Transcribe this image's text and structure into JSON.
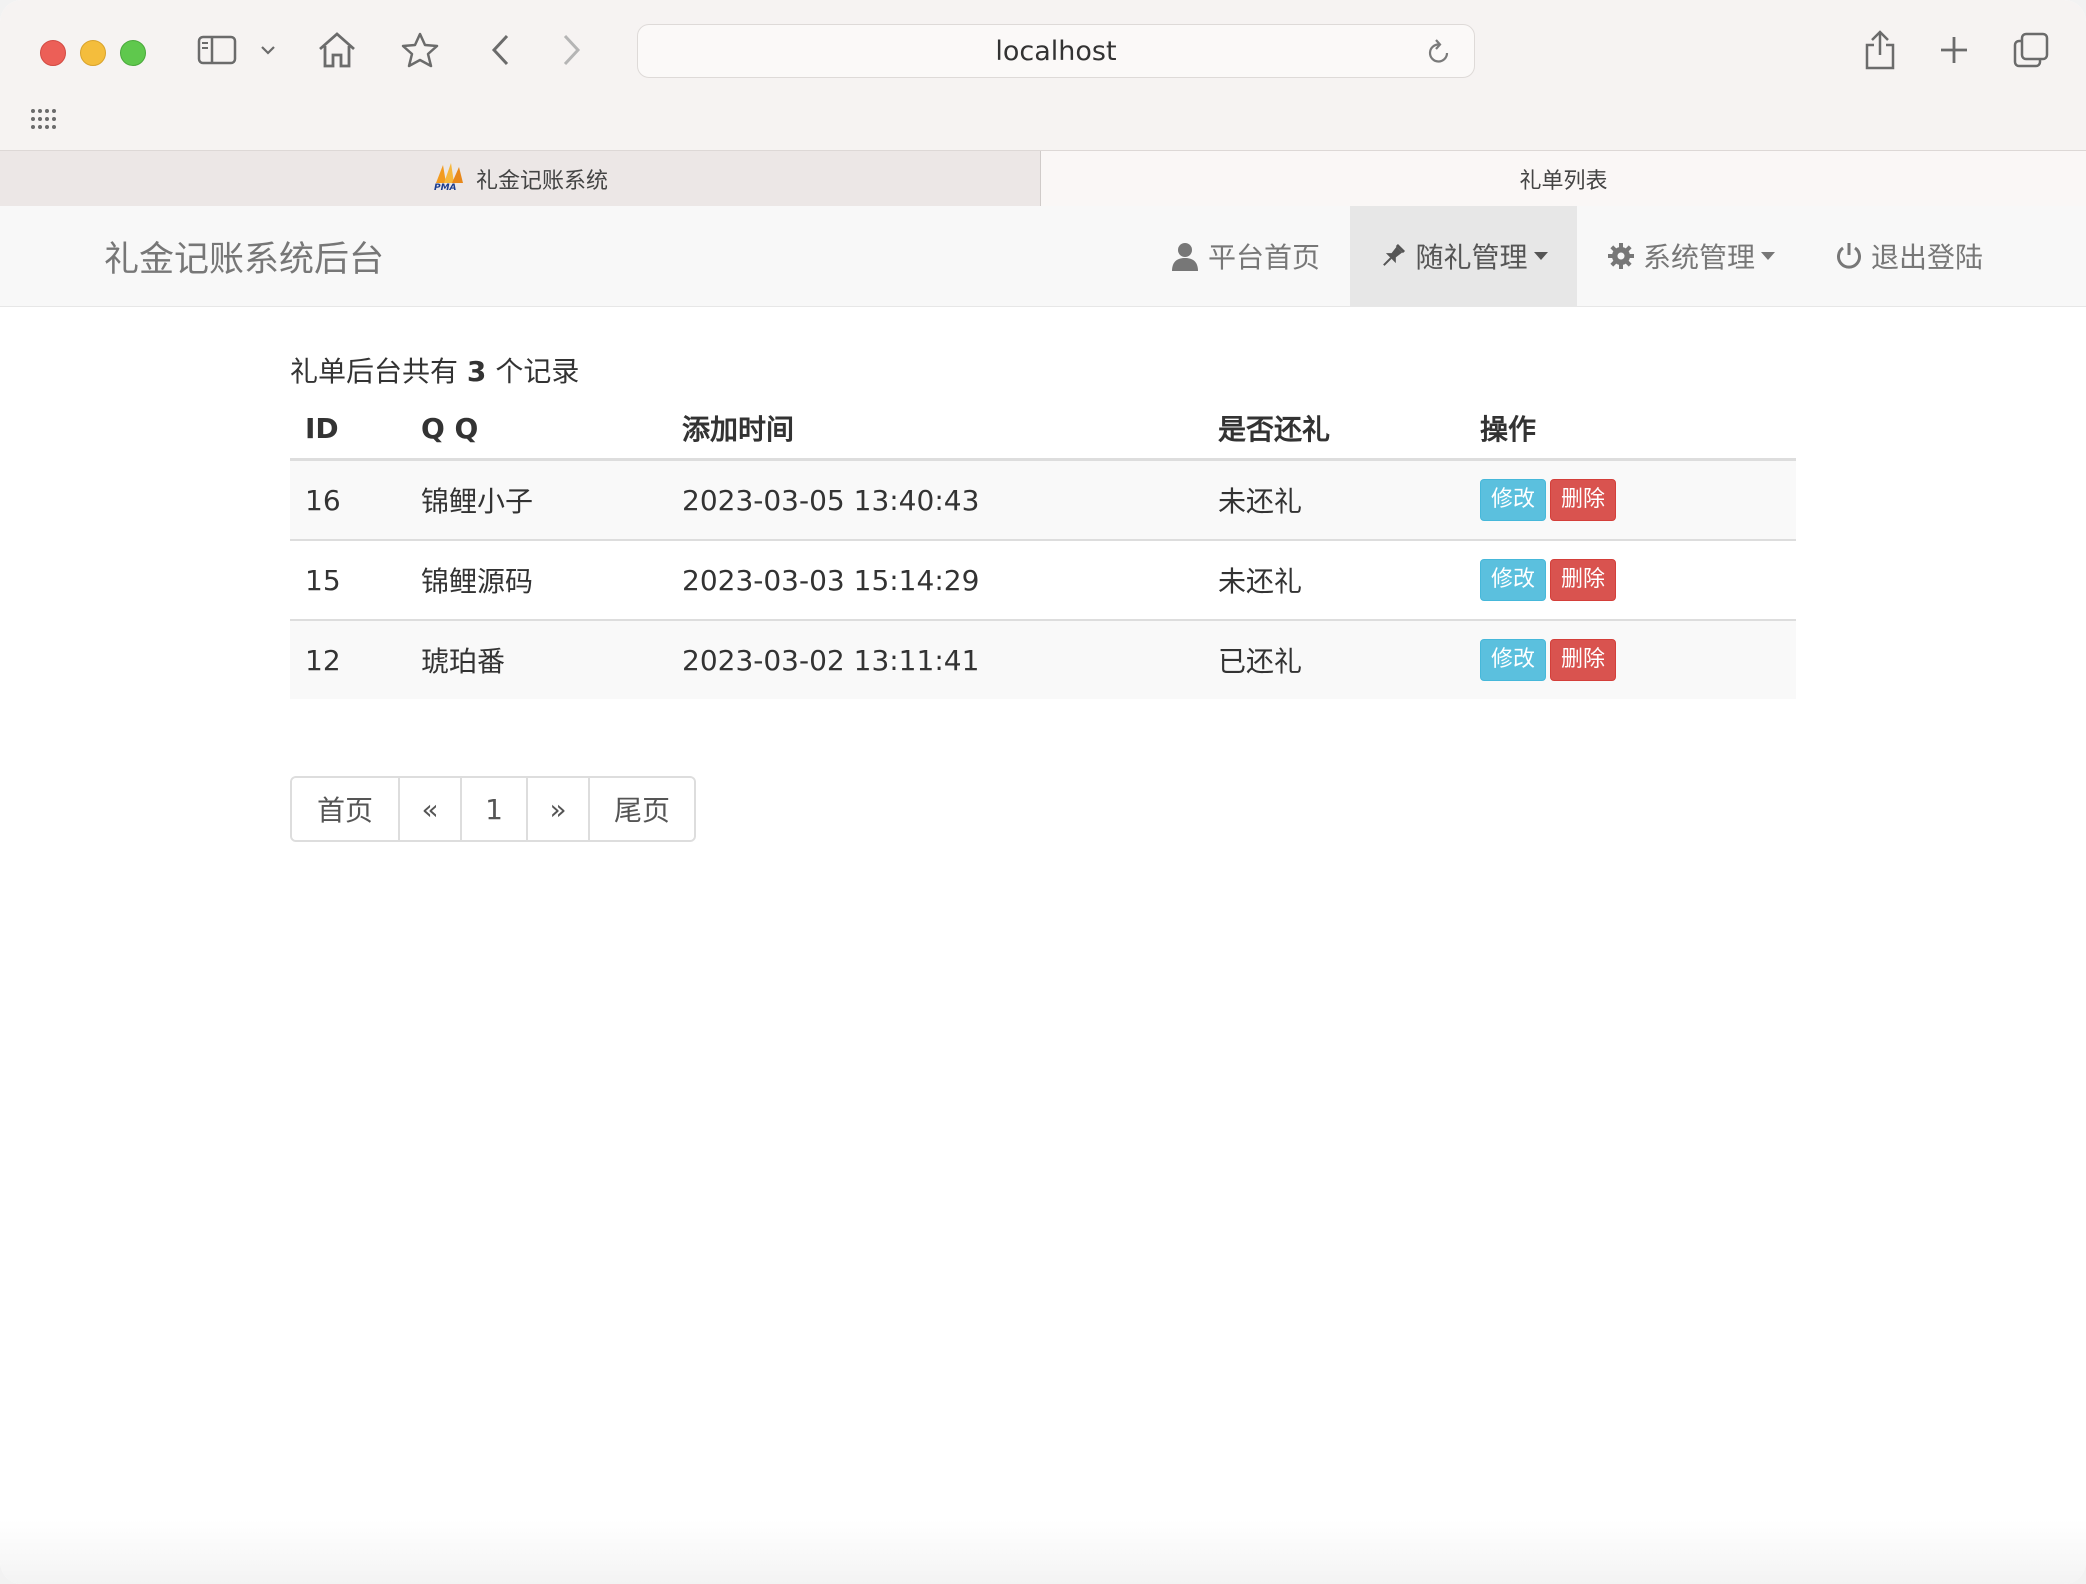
{
  "browser": {
    "url": "localhost",
    "tabs": [
      {
        "label": "礼金记账系统",
        "active": false
      },
      {
        "label": "礼单列表",
        "active": true
      }
    ]
  },
  "navbar": {
    "brand": "礼金记账系统后台",
    "items": [
      {
        "label": "平台首页",
        "icon": "user-icon",
        "dropdown": false,
        "active": false
      },
      {
        "label": "随礼管理",
        "icon": "pushpin-icon",
        "dropdown": true,
        "active": true
      },
      {
        "label": "系统管理",
        "icon": "gear-icon",
        "dropdown": true,
        "active": false
      },
      {
        "label": "退出登陆",
        "icon": "power-icon",
        "dropdown": false,
        "active": false
      }
    ]
  },
  "summary": {
    "prefix": "礼单后台共有",
    "count": "3",
    "suffix": "个记录"
  },
  "table": {
    "headers": [
      "ID",
      "Q Q",
      "添加时间",
      "是否还礼",
      "操作"
    ],
    "rows": [
      {
        "id": "16",
        "qq": "锦鲤小子",
        "time": "2023-03-05 13:40:43",
        "returned": "未还礼"
      },
      {
        "id": "15",
        "qq": "锦鲤源码",
        "time": "2023-03-03 15:14:29",
        "returned": "未还礼"
      },
      {
        "id": "12",
        "qq": "琥珀番",
        "time": "2023-03-02 13:11:41",
        "returned": "已还礼"
      }
    ],
    "edit_label": "修改",
    "delete_label": "删除"
  },
  "pagination": {
    "first": "首页",
    "prev": "«",
    "current": "1",
    "next": "»",
    "last": "尾页"
  },
  "colors": {
    "edit_button": "#5bc0de",
    "delete_button": "#d9534f",
    "navbar_bg": "#f8f8f8"
  }
}
